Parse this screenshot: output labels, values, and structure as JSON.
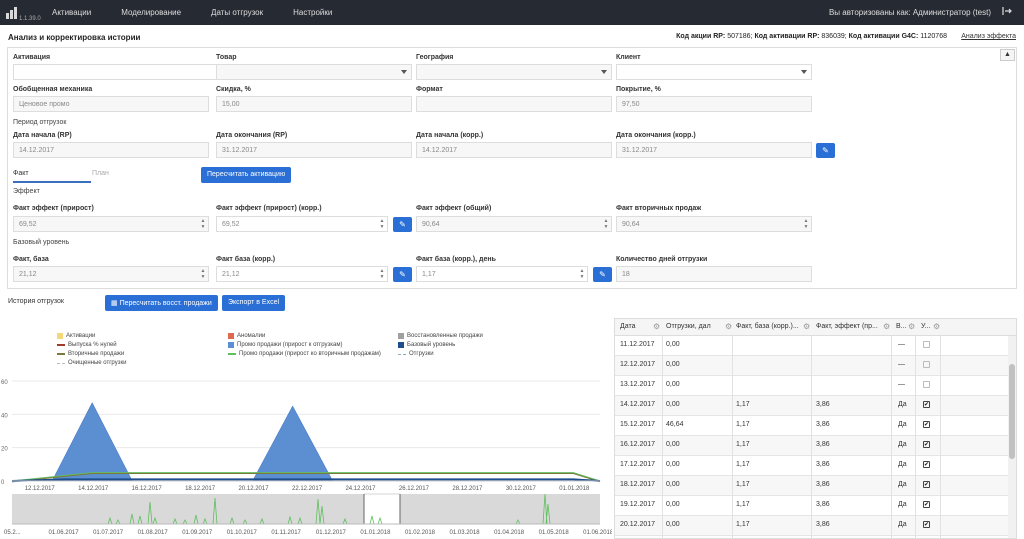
{
  "app": {
    "version": "1.1.39.0"
  },
  "nav": {
    "items": [
      "Активации",
      "Моделирование",
      "Даты отгрузок",
      "Настройки"
    ]
  },
  "user": {
    "auth_text": "Вы авторизованы как: Администратор (test)"
  },
  "page": {
    "title": "Анализ и корректировка истории",
    "codes": {
      "rp_action_label": "Код акции RP:",
      "rp_action_value": " 507186;",
      "rp_activation_label": " Код активации RP:",
      "rp_activation_value": " 836039;",
      "g4c_label": " Код активации G4C:",
      "g4c_value": " 1120768"
    },
    "effect_link": "Анализ эффекта"
  },
  "form": {
    "activation": {
      "label": "Активация",
      "value": ""
    },
    "product": {
      "label": "Товар",
      "value": ""
    },
    "geography": {
      "label": "География",
      "value": ""
    },
    "client": {
      "label": "Клиент",
      "value": ""
    },
    "mechanics": {
      "label": "Обобщенная механика",
      "value": "Ценовое промо"
    },
    "discount": {
      "label": "Скидка, %",
      "value": "15,00"
    },
    "format": {
      "label": "Формат",
      "value": ""
    },
    "coverage": {
      "label": "Покрытие, %",
      "value": "97,50"
    },
    "period_label": "Период отгрузок",
    "start_rp": {
      "label": "Дата начала (RP)",
      "value": "14.12.2017"
    },
    "end_rp": {
      "label": "Дата окончания (RP)",
      "value": "31.12.2017"
    },
    "start_corr": {
      "label": "Дата начала (корр.)",
      "value": "14.12.2017"
    },
    "end_corr": {
      "label": "Дата окончания (корр.)",
      "value": "31.12.2017"
    },
    "tabs": {
      "fact": "Факт",
      "plan": "План"
    },
    "recalc_button": "Пересчитать активацию",
    "effect_section": "Эффект",
    "fact_effect": {
      "label": "Факт эффект (прирост)",
      "value": "69,52"
    },
    "fact_effect_corr": {
      "label": "Факт эффект (прирост) (корр.)",
      "value": "69,52"
    },
    "fact_effect_total": {
      "label": "Факт эффект (общий)",
      "value": "90,64"
    },
    "fact_secondary": {
      "label": "Факт вторичных продаж",
      "value": "90,64"
    },
    "base_section": "Базовый уровень",
    "fact_base": {
      "label": "Факт, база",
      "value": "21,12"
    },
    "fact_base_corr": {
      "label": "Факт база (корр.)",
      "value": "21,12"
    },
    "fact_base_day": {
      "label": "Факт база (корр.), день",
      "value": "1,17"
    },
    "ship_days": {
      "label": "Количество дней отгрузки",
      "value": "18"
    }
  },
  "history": {
    "label": "История отгрузок",
    "recalc_button": "Пересчитать восст. продажи",
    "export_button": "Экспорт в Excel",
    "legend": [
      {
        "label": "Активации",
        "color": "#f3d77a",
        "kind": "box"
      },
      {
        "label": "Аномалии",
        "color": "#e0684f",
        "kind": "box"
      },
      {
        "label": "Восстановленные продажи",
        "color": "#a0a0a0",
        "kind": "box"
      },
      {
        "label": "Выпуска % нулей",
        "color": "#a13b2a",
        "kind": "line"
      },
      {
        "label": "Промо продажи (прирост к отгрузкам)",
        "color": "#5b8fd1",
        "kind": "box"
      },
      {
        "label": "Базовый уровень",
        "color": "#1f4e8c",
        "kind": "box"
      },
      {
        "label": "Вторичные продажи",
        "color": "#7a7a3a",
        "kind": "line"
      },
      {
        "label": "Промо продажи (прирост ко вторичным продажам)",
        "color": "#5fbf5f",
        "kind": "line"
      },
      {
        "label": "Отгрузки",
        "color": "#8ab",
        "kind": "dash"
      },
      {
        "label": "Очищенные отгрузки",
        "color": "#bbb",
        "kind": "dash"
      }
    ]
  },
  "chart_data": {
    "type": "area",
    "x": [
      "12.12.2017",
      "14.12.2017",
      "16.12.2017",
      "18.12.2017",
      "20.12.2017",
      "22.12.2017",
      "24.12.2017",
      "26.12.2017",
      "28.12.2017",
      "30.12.2017",
      "01.01.2018"
    ],
    "ylim": [
      0,
      60
    ],
    "yticks": [
      0,
      20,
      40,
      60
    ],
    "series": [
      {
        "name": "Промо продажи (прирост к отгрузкам)",
        "points": [
          [
            0,
            0
          ],
          [
            1.5,
            0
          ],
          [
            3,
            47
          ],
          [
            4.5,
            0
          ],
          [
            9,
            0
          ],
          [
            10.5,
            45
          ],
          [
            12,
            0
          ],
          [
            22,
            0
          ]
        ]
      },
      {
        "name": "Вторичные продажи",
        "points": [
          [
            0,
            0
          ],
          [
            3,
            5
          ],
          [
            21,
            5
          ],
          [
            22,
            0
          ]
        ]
      },
      {
        "name": "Базовый уровень",
        "points": [
          [
            0,
            0
          ],
          [
            2,
            1
          ],
          [
            21,
            1
          ],
          [
            22,
            0
          ]
        ]
      }
    ],
    "navigator_ticks": [
      "05.2...",
      "01.06.2017",
      "01.07.2017",
      "01.08.2017",
      "01.09.2017",
      "01.10.2017",
      "01.11.2017",
      "01.12.2017",
      "01.01.2018",
      "01.02.2018",
      "01.03.2018",
      "01.04.2018",
      "01.05.2018",
      "01.06.2018"
    ]
  },
  "table": {
    "columns": [
      "Дата",
      "Отгрузки, дал",
      "Факт, база (корр.)...",
      "Факт, эффект (пр...",
      "В...",
      "У..."
    ],
    "rows": [
      [
        "11.12.2017",
        "0,00",
        "",
        "",
        "—",
        "off"
      ],
      [
        "12.12.2017",
        "0,00",
        "",
        "",
        "—",
        "off"
      ],
      [
        "13.12.2017",
        "0,00",
        "",
        "",
        "—",
        "off"
      ],
      [
        "14.12.2017",
        "0,00",
        "1,17",
        "3,86",
        "Да",
        "on"
      ],
      [
        "15.12.2017",
        "46,64",
        "1,17",
        "3,86",
        "Да",
        "on"
      ],
      [
        "16.12.2017",
        "0,00",
        "1,17",
        "3,86",
        "Да",
        "on"
      ],
      [
        "17.12.2017",
        "0,00",
        "1,17",
        "3,86",
        "Да",
        "on"
      ],
      [
        "18.12.2017",
        "0,00",
        "1,17",
        "3,86",
        "Да",
        "on"
      ],
      [
        "19.12.2017",
        "0,00",
        "1,17",
        "3,86",
        "Да",
        "on"
      ],
      [
        "20.12.2017",
        "0,00",
        "1,17",
        "3,86",
        "Да",
        "on"
      ]
    ]
  }
}
